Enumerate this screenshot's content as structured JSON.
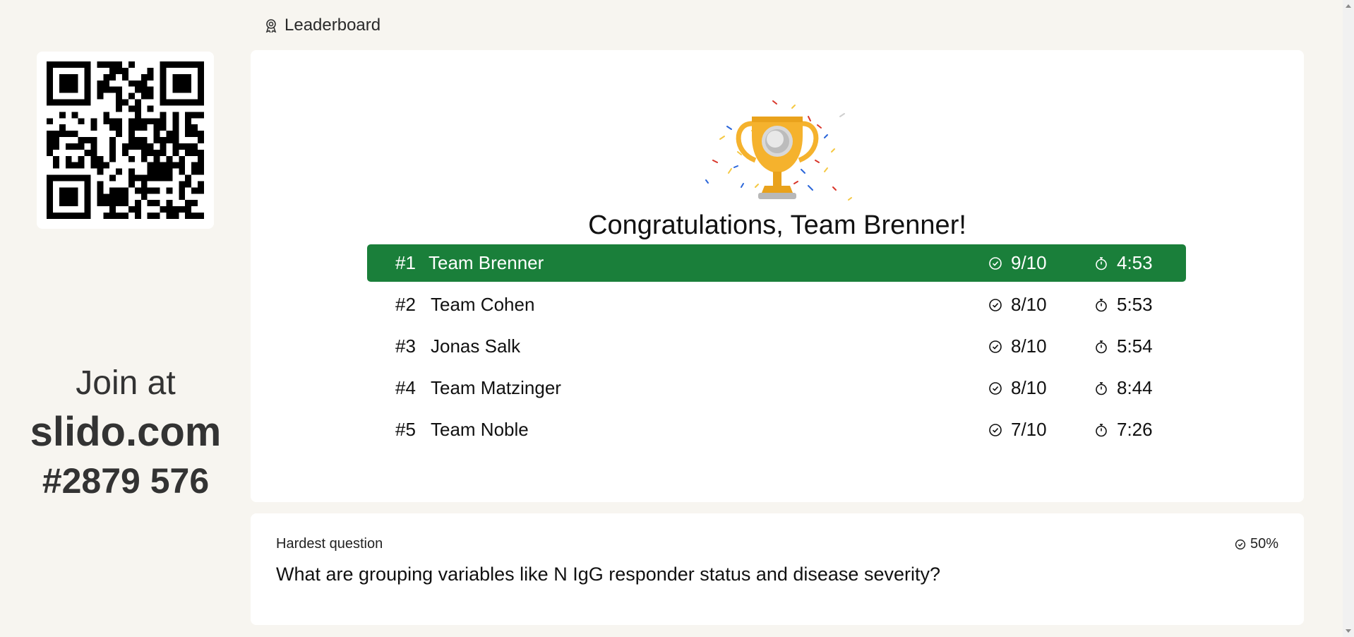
{
  "header": {
    "title": "Leaderboard",
    "icon": "badge-ribbon-icon"
  },
  "join": {
    "at": "Join at",
    "domain": "slido.com",
    "code": "#2879 576"
  },
  "congrats": "Congratulations, Team Brenner!",
  "leaderboard": [
    {
      "rank": "#1",
      "name": "Team Brenner",
      "score": "9/10",
      "time": "4:53"
    },
    {
      "rank": "#2",
      "name": "Team Cohen",
      "score": "8/10",
      "time": "5:53"
    },
    {
      "rank": "#3",
      "name": "Jonas Salk",
      "score": "8/10",
      "time": "5:54"
    },
    {
      "rank": "#4",
      "name": "Team Matzinger",
      "score": "8/10",
      "time": "8:44"
    },
    {
      "rank": "#5",
      "name": "Team Noble",
      "score": "7/10",
      "time": "7:26"
    }
  ],
  "hardest": {
    "label": "Hardest question",
    "question": "What are grouping variables like N IgG responder status and disease severity?",
    "percent": "50%"
  },
  "colors": {
    "winner": "#1a7f3a",
    "background": "#f7f5f0",
    "trophy": "#f5b22d"
  }
}
